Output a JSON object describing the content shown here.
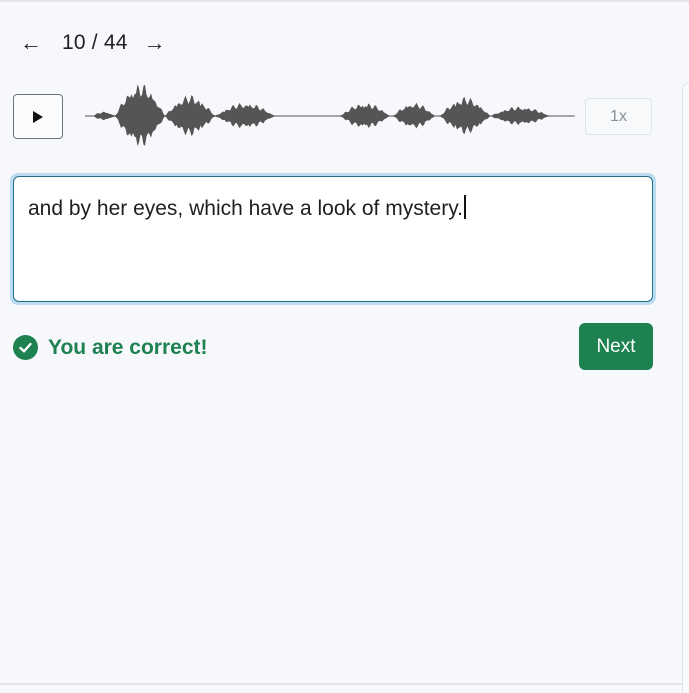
{
  "navigation": {
    "prev_icon": "←",
    "next_icon": "→",
    "counter": "10 / 44"
  },
  "player": {
    "play_icon": "play-triangle",
    "speed_label": "1x"
  },
  "answer": {
    "value": "and by her eyes, which have a look of mystery."
  },
  "result": {
    "message": "You are correct!",
    "icon": "check-circle"
  },
  "actions": {
    "next_label": "Next"
  },
  "colors": {
    "success": "#1d8150",
    "waveform": "#555555",
    "focus_ring": "#bcdcf2",
    "input_border": "#1f6f86"
  }
}
